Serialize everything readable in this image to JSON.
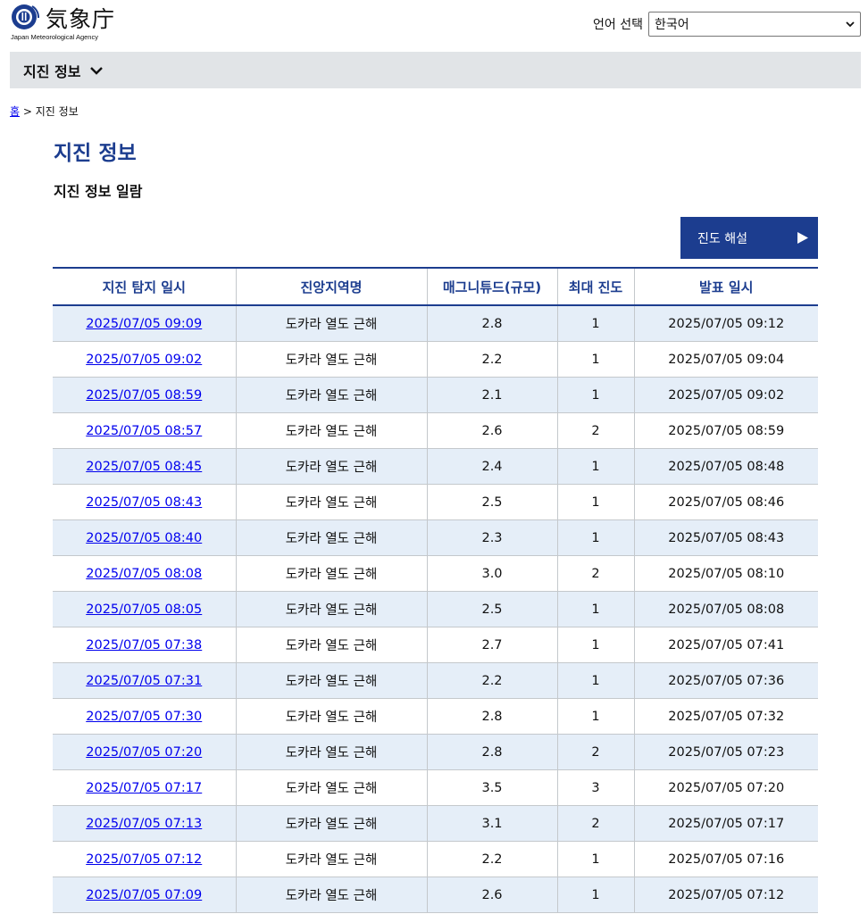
{
  "logo": {
    "text": "気象庁",
    "subtitle": "Japan Meteorological Agency",
    "icon": "jma-logo-icon"
  },
  "language": {
    "label": "언어 선택",
    "selected": "한국어",
    "icon": "chevron-down-icon"
  },
  "nav": {
    "title": "지진 정보",
    "icon": "chevron-down-icon"
  },
  "breadcrumb": {
    "home": "홈",
    "separator": ">",
    "current": "지진 정보"
  },
  "page": {
    "title": "지진 정보",
    "subtitle": "지진 정보 일람"
  },
  "intensity_button": {
    "label": "진도 해설",
    "icon": "play-arrow-icon"
  },
  "table": {
    "headers": [
      "지진 탐지 일시",
      "진앙지역명",
      "매그니튜드(규모)",
      "최대 진도",
      "발표 일시"
    ],
    "rows": [
      [
        "2025/07/05 09:09",
        "도카라 열도 근해",
        "2.8",
        "1",
        "2025/07/05 09:12"
      ],
      [
        "2025/07/05 09:02",
        "도카라 열도 근해",
        "2.2",
        "1",
        "2025/07/05 09:04"
      ],
      [
        "2025/07/05 08:59",
        "도카라 열도 근해",
        "2.1",
        "1",
        "2025/07/05 09:02"
      ],
      [
        "2025/07/05 08:57",
        "도카라 열도 근해",
        "2.6",
        "2",
        "2025/07/05 08:59"
      ],
      [
        "2025/07/05 08:45",
        "도카라 열도 근해",
        "2.4",
        "1",
        "2025/07/05 08:48"
      ],
      [
        "2025/07/05 08:43",
        "도카라 열도 근해",
        "2.5",
        "1",
        "2025/07/05 08:46"
      ],
      [
        "2025/07/05 08:40",
        "도카라 열도 근해",
        "2.3",
        "1",
        "2025/07/05 08:43"
      ],
      [
        "2025/07/05 08:08",
        "도카라 열도 근해",
        "3.0",
        "2",
        "2025/07/05 08:10"
      ],
      [
        "2025/07/05 08:05",
        "도카라 열도 근해",
        "2.5",
        "1",
        "2025/07/05 08:08"
      ],
      [
        "2025/07/05 07:38",
        "도카라 열도 근해",
        "2.7",
        "1",
        "2025/07/05 07:41"
      ],
      [
        "2025/07/05 07:31",
        "도카라 열도 근해",
        "2.2",
        "1",
        "2025/07/05 07:36"
      ],
      [
        "2025/07/05 07:30",
        "도카라 열도 근해",
        "2.8",
        "1",
        "2025/07/05 07:32"
      ],
      [
        "2025/07/05 07:20",
        "도카라 열도 근해",
        "2.8",
        "2",
        "2025/07/05 07:23"
      ],
      [
        "2025/07/05 07:17",
        "도카라 열도 근해",
        "3.5",
        "3",
        "2025/07/05 07:20"
      ],
      [
        "2025/07/05 07:13",
        "도카라 열도 근해",
        "3.1",
        "2",
        "2025/07/05 07:17"
      ],
      [
        "2025/07/05 07:12",
        "도카라 열도 근해",
        "2.2",
        "1",
        "2025/07/05 07:16"
      ],
      [
        "2025/07/05 07:09",
        "도카라 열도 근해",
        "2.6",
        "1",
        "2025/07/05 07:12"
      ]
    ]
  },
  "colors": {
    "brand_blue": "#1c3d8f",
    "link": "#0000ee",
    "row_alt": "#e5eef8",
    "nav_bg": "#e1e4e7"
  }
}
